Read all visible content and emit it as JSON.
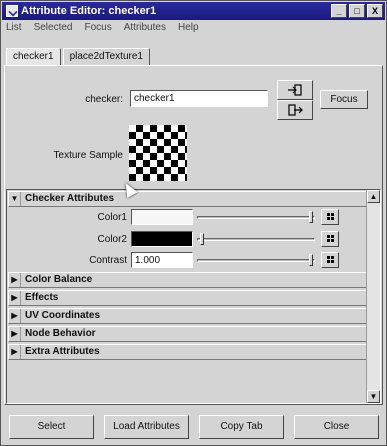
{
  "window": {
    "title": "Attribute Editor: checker1"
  },
  "titlebar_buttons": {
    "minimize": "_",
    "maximize": "□",
    "close": "X"
  },
  "menu": [
    "List",
    "Selected",
    "Focus",
    "Attributes",
    "Help"
  ],
  "tabs": [
    "checker1",
    "place2dTexture1"
  ],
  "node": {
    "label": "checker:",
    "value": "checker1",
    "focus_button": "Focus"
  },
  "texture_sample_label": "Texture Sample",
  "sections": {
    "checker_attributes": "Checker Attributes",
    "color_balance": "Color Balance",
    "effects": "Effects",
    "uv_coordinates": "UV Coordinates",
    "node_behavior": "Node Behavior",
    "extra_attributes": "Extra Attributes"
  },
  "attributes": {
    "color1": {
      "label": "Color1",
      "color": "#f7f7f7",
      "slider": 1.0
    },
    "color2": {
      "label": "Color2",
      "color": "#000000",
      "slider": 0.0
    },
    "contrast": {
      "label": "Contrast",
      "value": "1.000",
      "slider": 1.0
    }
  },
  "bottom_buttons": [
    "Select",
    "Load Attributes",
    "Copy Tab",
    "Close"
  ],
  "colors": {
    "title_bar": "#1a1a7e",
    "panel": "#d4d4d4"
  },
  "icons": {
    "section_expanded": "triangle-down-icon",
    "section_collapsed": "triangle-right-icon"
  }
}
